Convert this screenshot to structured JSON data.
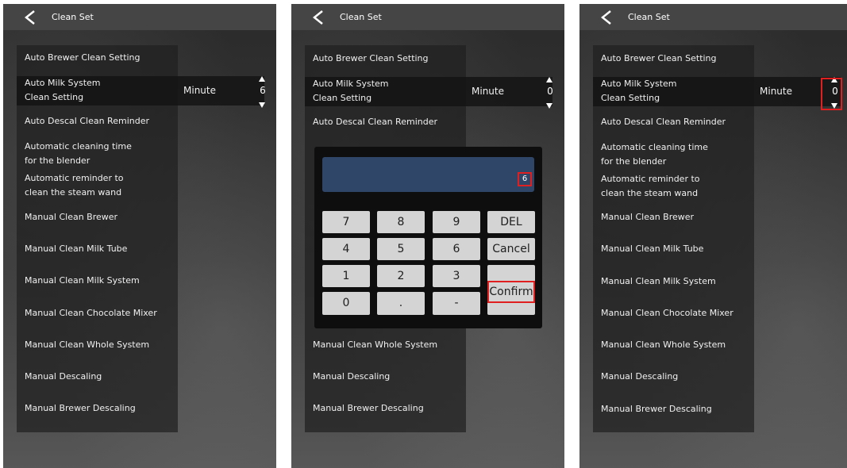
{
  "header": {
    "title": "Clean Set"
  },
  "menu": [
    {
      "label": "Auto Brewer Clean Setting"
    },
    {
      "label": "Auto Milk System\nClean Setting"
    },
    {
      "label": "Auto Descal Clean Reminder"
    },
    {
      "label": "Automatic cleaning time\nfor the blender"
    },
    {
      "label": "Automatic reminder to\nclean the steam wand"
    },
    {
      "label": "Manual Clean Brewer"
    },
    {
      "label": "Manual Clean Milk Tube"
    },
    {
      "label": "Manual Clean Milk System"
    },
    {
      "label": "Manual Clean Chocolate Mixer"
    },
    {
      "label": "Manual Clean Whole System"
    },
    {
      "label": "Manual Descaling"
    },
    {
      "label": "Manual Brewer Descaling"
    }
  ],
  "minute_label": "Minute",
  "panels": [
    {
      "stepper_value": "6"
    },
    {
      "stepper_value": "0",
      "display_value": "6"
    },
    {
      "stepper_value": "0"
    }
  ],
  "keypad": {
    "keys": [
      "7",
      "8",
      "9",
      "DEL",
      "4",
      "5",
      "6",
      "Cancel",
      "1",
      "2",
      "3",
      "Confirm",
      "0",
      ".",
      "-"
    ]
  },
  "colors": {
    "highlight": "#e02020",
    "display_bg": "#2f4668",
    "key_bg": "#d4d4d4"
  }
}
